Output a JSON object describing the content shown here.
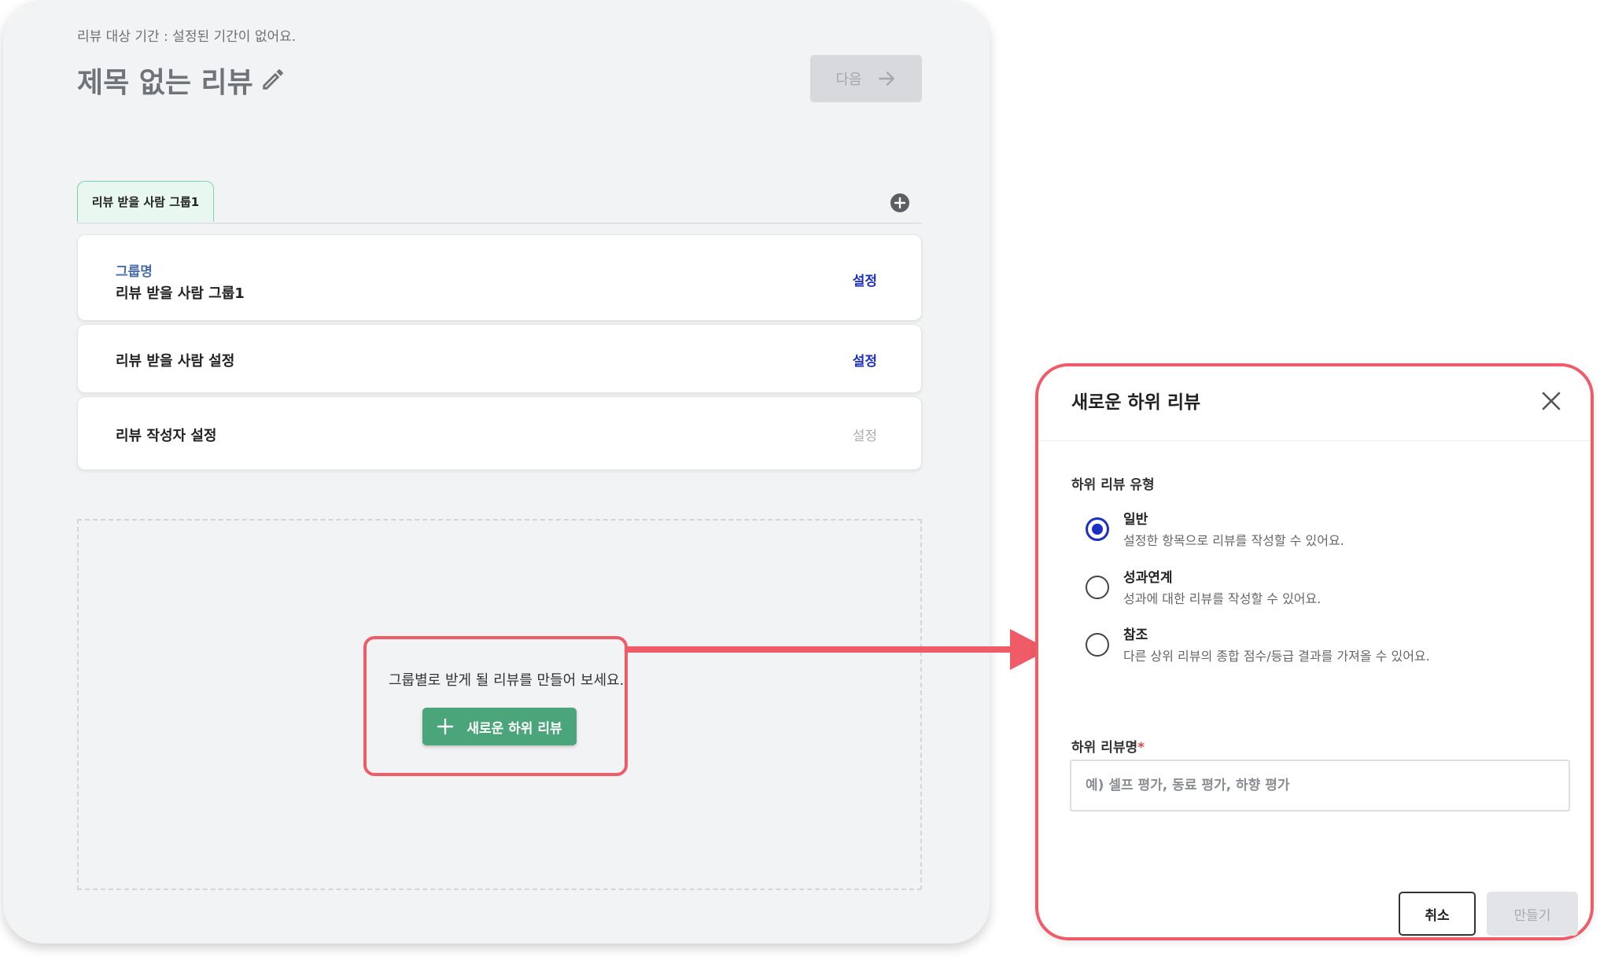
{
  "header": {
    "period_text": "리뷰 대상 기간 : 설정된 기간이 없어요.",
    "title": "제목 없는 리뷰",
    "next_label": "다음"
  },
  "tabs": [
    {
      "label": "리뷰 받을 사람 그룹1",
      "active": true
    }
  ],
  "rows": {
    "group": {
      "caption": "그룹명",
      "value": "리뷰 받을 사람 그룹1",
      "action": "설정"
    },
    "reviewee": {
      "label": "리뷰 받을 사람 설정",
      "action": "설정"
    },
    "reviewer": {
      "label": "리뷰 작성자 설정",
      "action": "설정"
    }
  },
  "empty_state": {
    "text": "그룹별로 받게 될 리뷰를 만들어 보세요.",
    "button_label": "새로운 하위 리뷰"
  },
  "modal": {
    "title": "새로운 하위 리뷰",
    "type_label": "하위 리뷰 유형",
    "options": [
      {
        "title": "일반",
        "desc": "설정한 항목으로 리뷰를 작성할 수 있어요.",
        "selected": true
      },
      {
        "title": "성과연계",
        "desc": "성과에 대한 리뷰를 작성할 수 있어요.",
        "selected": false
      },
      {
        "title": "참조",
        "desc": "다른 상위 리뷰의 종합 점수/등급 결과를 가져올 수 있어요.",
        "selected": false
      }
    ],
    "name_label": "하위 리뷰명",
    "required_mark": "*",
    "name_placeholder": "예) 셀프 평가, 동료 평가, 하향 평가",
    "name_value": "",
    "cancel_label": "취소",
    "create_label": "만들기"
  },
  "colors": {
    "link_active": "#1d2ec5",
    "link_disabled": "#a9acb0",
    "accent_green": "#4aa57a",
    "highlight_red": "#ef5b66"
  },
  "icons": {
    "edit": "pencil-icon",
    "next": "arrow-right-icon",
    "add_tab": "plus-circle-icon",
    "add_sub": "plus-icon",
    "close": "close-icon"
  }
}
